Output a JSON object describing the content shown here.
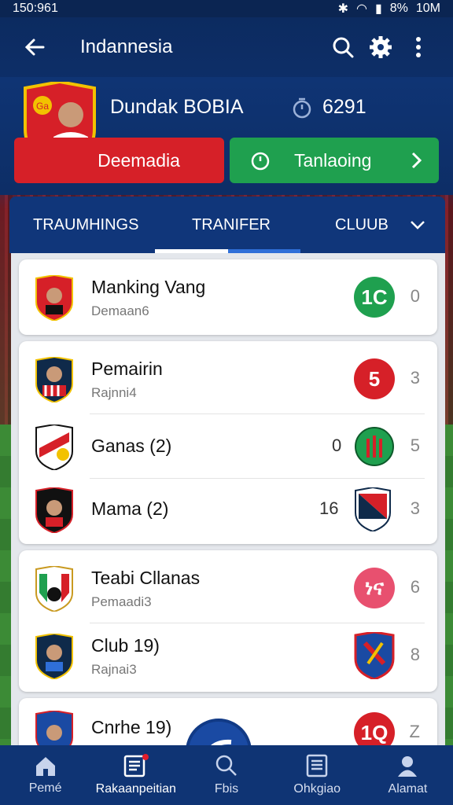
{
  "status_bar": {
    "time": "150:961",
    "battery": "8%",
    "clock": "10M"
  },
  "app_bar": {
    "title": "Indannesia"
  },
  "hero": {
    "name": "Dundak BOBIA",
    "stat_value": "6291",
    "crest_text": "Ga"
  },
  "buttons": {
    "red_label": "Deemadia",
    "green_label": "Tanlaoing"
  },
  "tabs": [
    {
      "label": "TRAUMHINGS"
    },
    {
      "label": "TRANIFER"
    },
    {
      "label": "CLUUB"
    }
  ],
  "rows": [
    {
      "name": "Manking Vang",
      "sub": "Demaan6",
      "badge": "1C",
      "badge_color": "#1fa04f",
      "num": "0"
    },
    {
      "name": "Pemairin",
      "sub": "Rajnni4",
      "badge": "5",
      "badge_color": "#d62028",
      "num": "3"
    },
    {
      "name": "Ganas (2)",
      "sub": "",
      "left_num": "0",
      "num": "5"
    },
    {
      "name": "Mama (2)",
      "sub": "",
      "left_num": "16",
      "num": "3"
    },
    {
      "name": "Teabi Cllanas",
      "sub": "Pemaadi3",
      "badge": "ነና",
      "badge_color": "#e8506f",
      "num": "6"
    },
    {
      "name": "Club 19)",
      "sub": "Rajnai3",
      "num": "8"
    },
    {
      "name": "Cnrhe 19)",
      "sub": "",
      "badge": "1Q",
      "badge_color": "#d62028",
      "num": "Z"
    }
  ],
  "bottom_nav": [
    {
      "label": "Pemé",
      "icon": "home-icon"
    },
    {
      "label": "Rakaanpeitian",
      "icon": "news-icon"
    },
    {
      "label": "Fbis",
      "icon": "search-icon"
    },
    {
      "label": "Ohkgiao",
      "icon": "list-icon"
    },
    {
      "label": "Alamat",
      "icon": "profile-icon"
    }
  ]
}
